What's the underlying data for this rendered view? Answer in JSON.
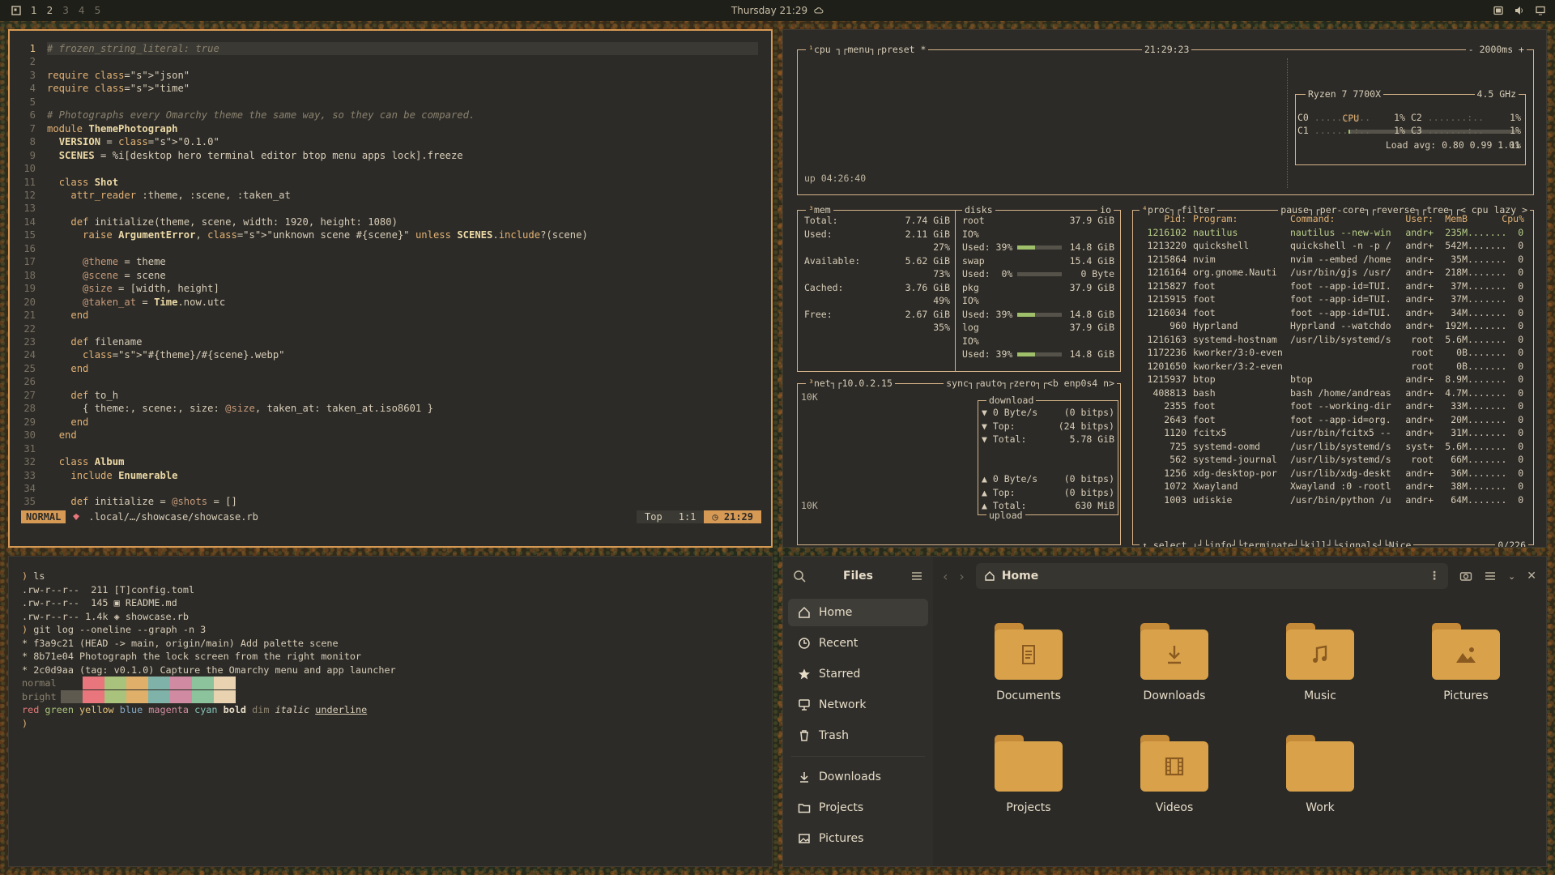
{
  "topbar": {
    "workspaces": [
      "1",
      "2",
      "3",
      "4",
      "5"
    ],
    "clock": "Thursday 21:29",
    "tray_icons": [
      "screen-icon",
      "volume-icon",
      "display-icon"
    ]
  },
  "editor": {
    "lines": [
      {
        "n": "1",
        "t": "# frozen_string_literal: true"
      },
      {
        "n": "2",
        "t": ""
      },
      {
        "n": "3",
        "t": "require \"json\""
      },
      {
        "n": "4",
        "t": "require \"time\""
      },
      {
        "n": "5",
        "t": ""
      },
      {
        "n": "6",
        "t": "# Photographs every Omarchy theme the same way, so they can be compared."
      },
      {
        "n": "7",
        "t": "module ThemePhotograph"
      },
      {
        "n": "8",
        "t": "  VERSION = \"0.1.0\""
      },
      {
        "n": "9",
        "t": "  SCENES = %i[desktop hero terminal editor btop menu apps lock].freeze"
      },
      {
        "n": "10",
        "t": ""
      },
      {
        "n": "11",
        "t": "  class Shot"
      },
      {
        "n": "12",
        "t": "    attr_reader :theme, :scene, :taken_at"
      },
      {
        "n": "13",
        "t": ""
      },
      {
        "n": "14",
        "t": "    def initialize(theme, scene, width: 1920, height: 1080)"
      },
      {
        "n": "15",
        "t": "      raise ArgumentError, \"unknown scene #{scene}\" unless SCENES.include?(scene)"
      },
      {
        "n": "16",
        "t": ""
      },
      {
        "n": "17",
        "t": "      @theme = theme"
      },
      {
        "n": "18",
        "t": "      @scene = scene"
      },
      {
        "n": "19",
        "t": "      @size = [width, height]"
      },
      {
        "n": "20",
        "t": "      @taken_at = Time.now.utc"
      },
      {
        "n": "21",
        "t": "    end"
      },
      {
        "n": "22",
        "t": ""
      },
      {
        "n": "23",
        "t": "    def filename"
      },
      {
        "n": "24",
        "t": "      \"#{theme}/#{scene}.webp\""
      },
      {
        "n": "25",
        "t": "    end"
      },
      {
        "n": "26",
        "t": ""
      },
      {
        "n": "27",
        "t": "    def to_h"
      },
      {
        "n": "28",
        "t": "      { theme:, scene:, size: @size, taken_at: taken_at.iso8601 }"
      },
      {
        "n": "29",
        "t": "    end"
      },
      {
        "n": "30",
        "t": "  end"
      },
      {
        "n": "31",
        "t": ""
      },
      {
        "n": "32",
        "t": "  class Album"
      },
      {
        "n": "33",
        "t": "    include Enumerable"
      },
      {
        "n": "34",
        "t": ""
      },
      {
        "n": "35",
        "t": "    def initialize = @shots = []"
      }
    ],
    "status": {
      "mode": "NORMAL",
      "file": ".local/…/showcase/showcase.rb",
      "pos_label": "Top",
      "cursor": "1:1",
      "time": "21:29"
    }
  },
  "btop": {
    "cpu": {
      "title": "cpu",
      "menu": "menu",
      "preset": "preset *",
      "time": "21:29:23",
      "interval": "- 2000ms +",
      "uptime": "up 04:26:40",
      "model": "Ryzen 7 7700X",
      "freq": "4.5 GHz",
      "total_label": "CPU",
      "total_pct": "1%",
      "cores": [
        {
          "name": "C0",
          "pct": "1%"
        },
        {
          "name": "C2",
          "pct": "1%"
        },
        {
          "name": "C1",
          "pct": "1%"
        },
        {
          "name": "C3",
          "pct": "1%"
        }
      ],
      "load": "Load avg: 0.80 0.99 1.01"
    },
    "mem": {
      "title": "mem",
      "rows": [
        {
          "label": "Total:",
          "value": "7.74 GiB"
        },
        {
          "label": "Used:",
          "value": "2.11 GiB"
        },
        {
          "label": "",
          "value": "27%"
        },
        {
          "label": "Available:",
          "value": "5.62 GiB"
        },
        {
          "label": "",
          "value": "73%"
        },
        {
          "label": "Cached:",
          "value": "3.76 GiB"
        },
        {
          "label": "",
          "value": "49%"
        },
        {
          "label": "Free:",
          "value": "2.67 GiB"
        },
        {
          "label": "",
          "value": "35%"
        }
      ]
    },
    "disks": {
      "title": "disks",
      "io": "io",
      "rows": [
        {
          "label": "root",
          "value": "37.9 GiB"
        },
        {
          "label": "IO%",
          "value": ""
        },
        {
          "label": "Used: 39%",
          "value": "14.8 GiB",
          "fill": 0.39
        },
        {
          "label": "swap",
          "value": "15.4 GiB"
        },
        {
          "label": "Used:  0%",
          "value": "0 Byte",
          "fill": 0
        },
        {
          "label": "pkg",
          "value": "37.9 GiB"
        },
        {
          "label": "IO%",
          "value": ""
        },
        {
          "label": "Used: 39%",
          "value": "14.8 GiB",
          "fill": 0.39
        },
        {
          "label": "log",
          "value": "37.9 GiB"
        },
        {
          "label": "IO%",
          "value": ""
        },
        {
          "label": "Used: 39%",
          "value": "14.8 GiB",
          "fill": 0.39
        }
      ]
    },
    "net": {
      "title": "net",
      "ip": "10.0.2.15",
      "sync": "sync",
      "auto": "auto",
      "zero": "zero",
      "iface": "<b enp0s4 n>",
      "scale_top": "10K",
      "scale_bottom": "10K",
      "download_label": "download",
      "upload_label": "upload",
      "down": [
        {
          "k": "▼ 0 Byte/s",
          "v": "(0 bitps)"
        },
        {
          "k": "▼ Top:",
          "v": "(24 bitps)"
        },
        {
          "k": "▼ Total:",
          "v": "5.78 GiB"
        }
      ],
      "up": [
        {
          "k": "▲ 0 Byte/s",
          "v": "(0 bitps)"
        },
        {
          "k": "▲ Top:",
          "v": "(0 bitps)"
        },
        {
          "k": "▲ Total:",
          "v": "630 MiB"
        }
      ]
    },
    "proc": {
      "title": "proc",
      "filter": "filter",
      "pause": "pause",
      "per_core": "per-core",
      "reverse": "reverse",
      "tree": "tree",
      "sort": "< cpu lazy >",
      "headers": [
        "Pid:",
        "Program:",
        "Command:",
        "User:",
        "MemB",
        "Cpu%"
      ],
      "rows": [
        [
          "1216102",
          "nautilus",
          "nautilus --new-win",
          "andr+",
          "235M",
          "0.0"
        ],
        [
          "1213220",
          "quickshell",
          "quickshell -n -p /",
          "andr+",
          "542M",
          "0.0"
        ],
        [
          "1215864",
          "nvim",
          "nvim --embed /home",
          "andr+",
          "35M",
          "0.1"
        ],
        [
          "1216164",
          "org.gnome.Nauti",
          "/usr/bin/gjs /usr/",
          "andr+",
          "218M",
          "0.0"
        ],
        [
          "1215827",
          "foot",
          "foot --app-id=TUI.",
          "andr+",
          "37M",
          "0.0"
        ],
        [
          "1215915",
          "foot",
          "foot --app-id=TUI.",
          "andr+",
          "37M",
          "0.0"
        ],
        [
          "1216034",
          "foot",
          "foot --app-id=TUI.",
          "andr+",
          "34M",
          "0.0"
        ],
        [
          "960",
          "Hyprland",
          "Hyprland --watchdo",
          "andr+",
          "192M",
          "0.1"
        ],
        [
          "1216163",
          "systemd-hostnam",
          "/usr/lib/systemd/s",
          "root",
          "5.6M",
          "0.0"
        ],
        [
          "1172236",
          "kworker/3:0-even",
          "",
          "root",
          "0B",
          "0.0"
        ],
        [
          "1201650",
          "kworker/3:2-even",
          "",
          "root",
          "0B",
          "0.0"
        ],
        [
          "1215937",
          "btop",
          "btop",
          "andr+",
          "8.9M",
          "0.1"
        ],
        [
          "408813",
          "bash",
          "bash /home/andreas",
          "andr+",
          "4.7M",
          "0.0"
        ],
        [
          "2355",
          "foot",
          "foot --working-dir",
          "andr+",
          "33M",
          "0.0"
        ],
        [
          "2643",
          "foot",
          "foot --app-id=org.",
          "andr+",
          "20M",
          "0.0"
        ],
        [
          "1120",
          "fcitx5",
          "/usr/bin/fcitx5 --",
          "andr+",
          "31M",
          "0.0"
        ],
        [
          "725",
          "systemd-oomd",
          "/usr/lib/systemd/s",
          "syst+",
          "5.6M",
          "0.0"
        ],
        [
          "562",
          "systemd-journal",
          "/usr/lib/systemd/s",
          "root",
          "66M",
          "0.0"
        ],
        [
          "1256",
          "xdg-desktop-por",
          "/usr/lib/xdg-deskt",
          "andr+",
          "36M",
          "0.0"
        ],
        [
          "1072",
          "Xwayland",
          "Xwayland :0 -rootl",
          "andr+",
          "38M",
          "0.0"
        ],
        [
          "1003",
          "udiskie",
          "/usr/bin/python /u",
          "andr+",
          "64M",
          "0.0"
        ]
      ],
      "footer": {
        "select": "↑ select ↓",
        "info": "info",
        "terminate": "terminate",
        "kill": "kill",
        "signals": "signals",
        "nice": "Nice",
        "count": "0/226"
      }
    }
  },
  "terminal": {
    "lines": [
      {
        "p": ") ",
        "t": "ls"
      },
      {
        "p": "",
        "t": ".rw-r--r--  211 [T]config.toml"
      },
      {
        "p": "",
        "t": ".rw-r--r--  145 ▣ README.md"
      },
      {
        "p": "",
        "t": ".rw-r--r-- 1.4k ◈ showcase.rb"
      },
      {
        "p": ") ",
        "t": "git log --oneline --graph -n 3"
      },
      {
        "p": "",
        "t": "* f3a9c21 (HEAD -> main, origin/main) Add palette scene"
      },
      {
        "p": "",
        "t": "* 8b71e04 Photograph the lock screen from the right monitor"
      },
      {
        "p": "",
        "t": "* 2c0d9aa (tag: v0.1.0) Capture the Omarchy menu and app launcher"
      }
    ],
    "palette_normal_label": "normal",
    "palette_bright_label": "bright",
    "palette": [
      "#5f5a50",
      "#e8767c",
      "#a9c27c",
      "#e0b06a",
      "#7fb3a9",
      "#d08aa1",
      "#8cc29c",
      "#e8d2b0"
    ],
    "styles_line": [
      "red",
      "green",
      "yellow",
      "blue",
      "magenta",
      "cyan",
      "bold",
      "dim",
      "italic",
      "underline"
    ],
    "style_colors": [
      "#e87a7a",
      "#a9c27c",
      "#e3c07a",
      "#84a9c7",
      "#d08aa1",
      "#86c2b8",
      "#e6dcc8",
      "#8b826f",
      "#d8cdb8",
      "#d8cdb8"
    ],
    "final_prompt": ")"
  },
  "files": {
    "title": "Files",
    "sidebar": [
      {
        "label": "Home",
        "icon": "home-icon",
        "active": true
      },
      {
        "label": "Recent",
        "icon": "clock-icon"
      },
      {
        "label": "Starred",
        "icon": "star-icon"
      },
      {
        "label": "Network",
        "icon": "network-icon"
      },
      {
        "label": "Trash",
        "icon": "trash-icon"
      }
    ],
    "bookmarks": [
      {
        "label": "Downloads",
        "icon": "download-icon"
      },
      {
        "label": "Projects",
        "icon": "folder-icon"
      },
      {
        "label": "Pictures",
        "icon": "image-icon"
      }
    ],
    "path": "Home",
    "folders": [
      {
        "label": "Documents",
        "icon": "document"
      },
      {
        "label": "Downloads",
        "icon": "download"
      },
      {
        "label": "Music",
        "icon": "music"
      },
      {
        "label": "Pictures",
        "icon": "picture"
      },
      {
        "label": "Projects",
        "icon": ""
      },
      {
        "label": "Videos",
        "icon": "film"
      },
      {
        "label": "Work",
        "icon": ""
      }
    ]
  }
}
